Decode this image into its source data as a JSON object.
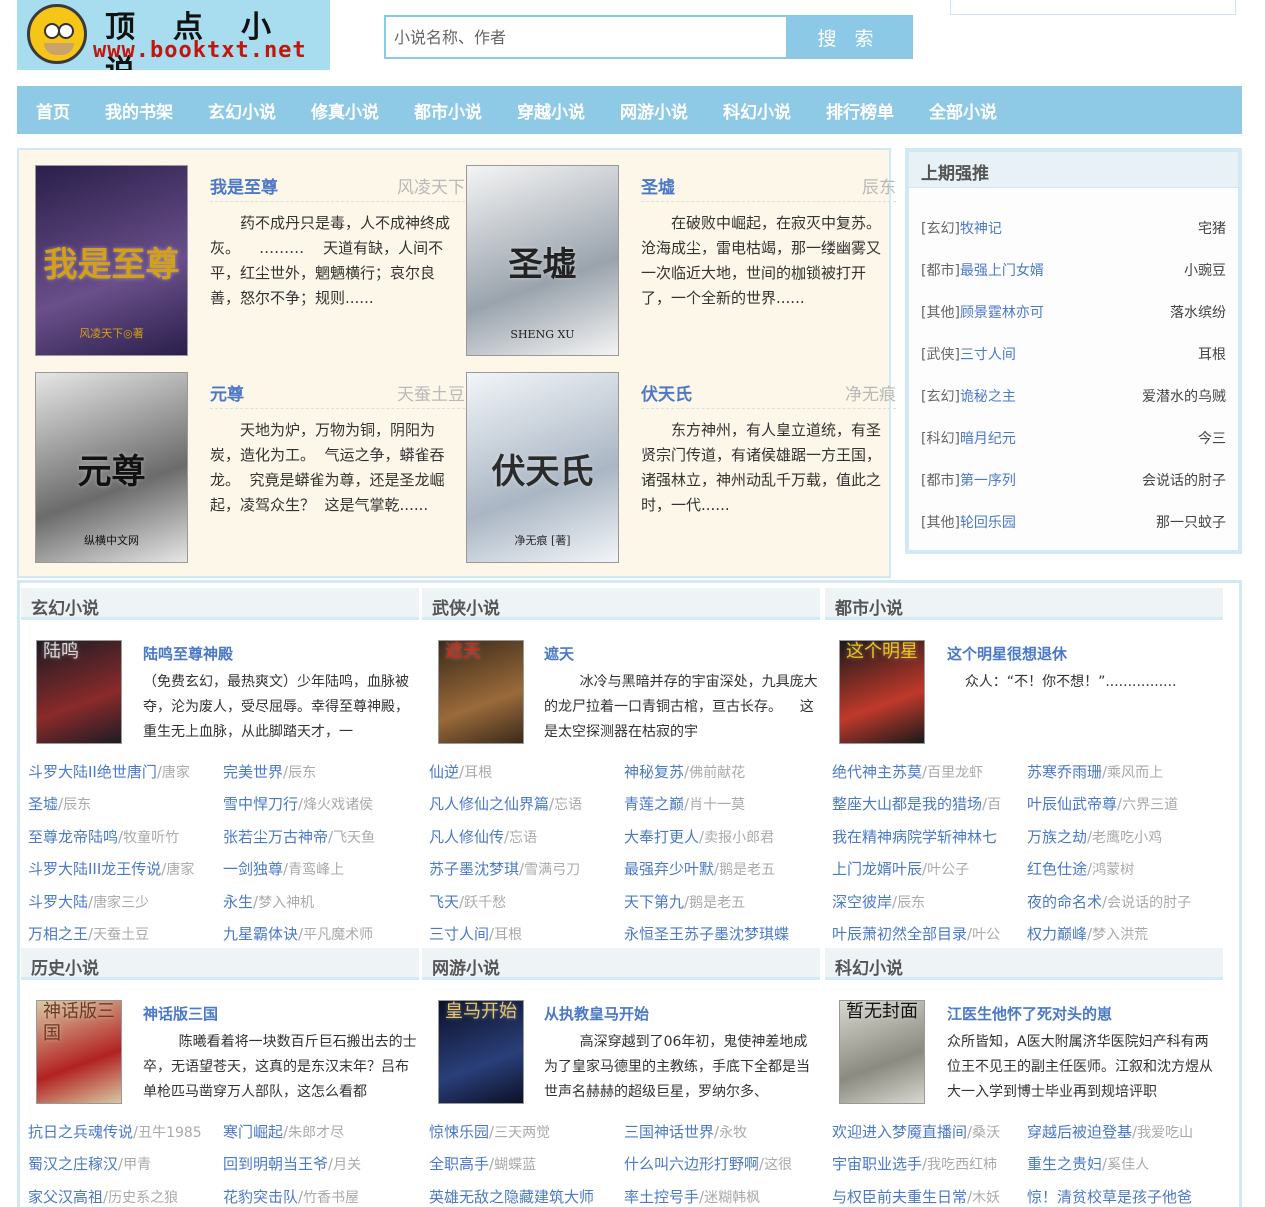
{
  "logo": {
    "title": "顶点小说",
    "url": "www.booktxt.net"
  },
  "search": {
    "placeholder": "小说名称、作者",
    "button": "搜 索"
  },
  "nav": [
    "首页",
    "我的书架",
    "玄幻小说",
    "修真小说",
    "都市小说",
    "穿越小说",
    "网游小说",
    "科幻小说",
    "排行榜单",
    "全部小说"
  ],
  "featured": [
    {
      "title": "我是至尊",
      "author": "风凌天下",
      "desc": "药不成丹只是毒，人不成神终成灰。    ………    天道有缺，人间不平，红尘世外，魍魉横行；哀尔良善，怒尔不争；规则......",
      "cover_text": "我是至尊",
      "cover_sub": "风凌天下◎著",
      "cover_colors": [
        "#2a1f4a",
        "#6a4f8a",
        "#d4a017"
      ]
    },
    {
      "title": "圣墟",
      "author": "辰东",
      "desc": "在破败中崛起，在寂灭中复苏。    沧海成尘，雷电枯竭，那一缕幽雾又一次临近大地，世间的枷锁被打开了，一个全新的世界......",
      "cover_text": "圣墟",
      "cover_sub": "SHENG XU",
      "cover_colors": [
        "#f4f4f4",
        "#9aa3ad",
        "#222222"
      ]
    },
    {
      "title": "元尊",
      "author": "天蚕土豆",
      "desc": "天地为炉，万物为铜，阴阳为炭，造化为工。  气运之争，蟒雀吞龙。  究竟是蟒雀为尊，还是圣龙崛起，凌驾众生？  这是气掌乾......",
      "cover_text": "元尊",
      "cover_sub": "纵横中文网",
      "cover_colors": [
        "#e6e6e6",
        "#6b6b6b",
        "#111111"
      ]
    },
    {
      "title": "伏天氏",
      "author": "净无痕",
      "desc": "东方神州，有人皇立道统，有圣贤宗门传道，有诸侯雄踞一方王国，诸强林立，神州动乱千万载，值此之时，一代......",
      "cover_text": "伏天氏",
      "cover_sub": "净无痕 [著]",
      "cover_colors": [
        "#f2f5f8",
        "#aab6c4",
        "#2b2b2b"
      ]
    }
  ],
  "recommend": {
    "heading": "上期强推",
    "items": [
      {
        "cat": "[玄幻]",
        "name": "牧神记",
        "author": "宅猪"
      },
      {
        "cat": "[都市]",
        "name": "最强上门女婿",
        "author": "小豌豆"
      },
      {
        "cat": "[其他]",
        "name": "顾景霆林亦可",
        "author": "落水缤纷"
      },
      {
        "cat": "[武侠]",
        "name": "三寸人间",
        "author": "耳根"
      },
      {
        "cat": "[玄幻]",
        "name": "诡秘之主",
        "author": "爱潜水的乌贼"
      },
      {
        "cat": "[科幻]",
        "name": "暗月纪元",
        "author": "今三"
      },
      {
        "cat": "[都市]",
        "name": "第一序列",
        "author": "会说话的肘子"
      },
      {
        "cat": "[其他]",
        "name": "轮回乐园",
        "author": "那一只蚊子"
      }
    ]
  },
  "categories": [
    {
      "heading": "玄幻小说",
      "feature": {
        "title": "陆鸣至尊神殿",
        "desc": "（免费玄幻，最热爽文）少年陆鸣，血脉被夺，沦为废人，受尽屈辱。幸得至尊神殿，重生无上血脉，从此脚踏天才，一",
        "cover_text": "陆鸣",
        "cover_colors": [
          "#1c1c24",
          "#8a2a2a",
          "#d9d9d9"
        ]
      },
      "items": [
        {
          "t": "斗罗大陆II绝世唐门",
          "a": "唐家"
        },
        {
          "t": "完美世界",
          "a": "辰东"
        },
        {
          "t": "圣墟",
          "a": "辰东"
        },
        {
          "t": "雪中悍刀行",
          "a": "烽火戏诸侯"
        },
        {
          "t": "至尊龙帝陆鸣",
          "a": "牧童听竹"
        },
        {
          "t": "张若尘万古神帝",
          "a": "飞天鱼"
        },
        {
          "t": "斗罗大陆III龙王传说",
          "a": "唐家"
        },
        {
          "t": "一剑独尊",
          "a": "青鸾峰上"
        },
        {
          "t": "斗罗大陆",
          "a": "唐家三少"
        },
        {
          "t": "永生",
          "a": "梦入神机"
        },
        {
          "t": "万相之王",
          "a": "天蚕土豆"
        },
        {
          "t": "九星霸体诀",
          "a": "平凡魔术师"
        }
      ]
    },
    {
      "heading": "武侠小说",
      "feature": {
        "title": "遮天",
        "desc": "        冰冷与黑暗并存的宇宙深处，九具庞大的龙尸拉着一口青铜古棺，亘古长存。    这是太空探测器在枯寂的宇",
        "cover_text": "遮天",
        "cover_colors": [
          "#3a2a1a",
          "#9a6a3a",
          "#d6261f"
        ]
      },
      "items": [
        {
          "t": "仙逆",
          "a": "耳根"
        },
        {
          "t": "神秘复苏",
          "a": "佛前献花"
        },
        {
          "t": "凡人修仙之仙界篇",
          "a": "忘语"
        },
        {
          "t": "青莲之巅",
          "a": "肖十一莫"
        },
        {
          "t": "凡人修仙传",
          "a": "忘语"
        },
        {
          "t": "大奉打更人",
          "a": "卖报小郎君"
        },
        {
          "t": "苏子墨沈梦琪",
          "a": "雪满弓刀"
        },
        {
          "t": "最强弃少叶默",
          "a": "鹅是老五"
        },
        {
          "t": "飞天",
          "a": "跃千愁"
        },
        {
          "t": "天下第九",
          "a": "鹅是老五"
        },
        {
          "t": "三寸人间",
          "a": "耳根"
        },
        {
          "t": "永恒圣王苏子墨沈梦琪蝶",
          "a": ""
        }
      ]
    },
    {
      "heading": "都市小说",
      "feature": {
        "title": "这个明星很想退休",
        "desc": "    众人：“不！你不想！”................",
        "cover_text": "这个明星",
        "cover_colors": [
          "#1a1a1a",
          "#c0392b",
          "#f1c40f"
        ]
      },
      "items": [
        {
          "t": "绝代神主苏莫",
          "a": "百里龙虾"
        },
        {
          "t": "苏寒乔雨珊",
          "a": "乘风而上"
        },
        {
          "t": "整座大山都是我的猎场",
          "a": "百"
        },
        {
          "t": "叶辰仙武帝尊",
          "a": "六界三道"
        },
        {
          "t": "我在精神病院学斩神林七",
          "a": ""
        },
        {
          "t": "万族之劫",
          "a": "老鹰吃小鸡"
        },
        {
          "t": "上门龙婿叶辰",
          "a": "叶公子"
        },
        {
          "t": "红色仕途",
          "a": "鸿蒙树"
        },
        {
          "t": "深空彼岸",
          "a": "辰东"
        },
        {
          "t": "夜的命名术",
          "a": "会说话的肘子"
        },
        {
          "t": "叶辰萧初然全部目录",
          "a": "叶公"
        },
        {
          "t": "权力巅峰",
          "a": "梦入洪荒"
        }
      ]
    },
    {
      "heading": "历史小说",
      "feature": {
        "title": "神话版三国",
        "desc": "        陈曦看着将一块数百斤巨石搬出去的士卒，无语望苍天，这真的是东汉末年？吕布单枪匹马凿穿万人部队，这怎么看都",
        "cover_text": "神话版三国",
        "cover_colors": [
          "#d9c9a3",
          "#b22222",
          "#6b3a1f"
        ]
      },
      "items": [
        {
          "t": "抗日之兵魂传说",
          "a": "丑牛1985"
        },
        {
          "t": "寒门崛起",
          "a": "朱郎才尽"
        },
        {
          "t": "蜀汉之庄稼汉",
          "a": "甲青"
        },
        {
          "t": "回到明朝当王爷",
          "a": "月关"
        },
        {
          "t": "家父汉高祖",
          "a": "历史系之狼"
        },
        {
          "t": "花豹突击队",
          "a": "竹香书屋"
        }
      ]
    },
    {
      "heading": "网游小说",
      "feature": {
        "title": "从执教皇马开始",
        "desc": "        高深穿越到了06年初，鬼使神差地成为了皇家马德里的主教练，手底下全都是当世声名赫赫的超级巨星，罗纳尔多、",
        "cover_text": "皇马开始",
        "cover_colors": [
          "#0b1026",
          "#2a3f7a",
          "#e6c66a"
        ]
      },
      "items": [
        {
          "t": "惊悚乐园",
          "a": "三天两觉"
        },
        {
          "t": "三国神话世界",
          "a": "永牧"
        },
        {
          "t": "全职高手",
          "a": "蝴蝶蓝"
        },
        {
          "t": "什么叫六边形打野啊",
          "a": "这很"
        },
        {
          "t": "英雄无敌之隐藏建筑大师",
          "a": ""
        },
        {
          "t": "率土控号手",
          "a": "迷糊韩枫"
        }
      ]
    },
    {
      "heading": "科幻小说",
      "feature": {
        "title": "江医生他怀了死对头的崽",
        "desc": "众所皆知，A医大附属济华医院妇产科有两位王不见王的副主任医师。江叙和沈方煜从大一入学到博士毕业再到规培评职",
        "cover_text": "暂无封面",
        "cover_colors": [
          "#d8d8d0",
          "#8a8a80",
          "#111111"
        ]
      },
      "items": [
        {
          "t": "欢迎进入梦魇直播间",
          "a": "桑沃"
        },
        {
          "t": "穿越后被迫登基",
          "a": "我爱吃山"
        },
        {
          "t": "宇宙职业选手",
          "a": "我吃西红柿"
        },
        {
          "t": "重生之贵妇",
          "a": "奚佳人"
        },
        {
          "t": "与权臣前夫重生日常",
          "a": "木妖"
        },
        {
          "t": "惊！清贫校草是孩子他爸",
          "a": ""
        }
      ]
    }
  ]
}
